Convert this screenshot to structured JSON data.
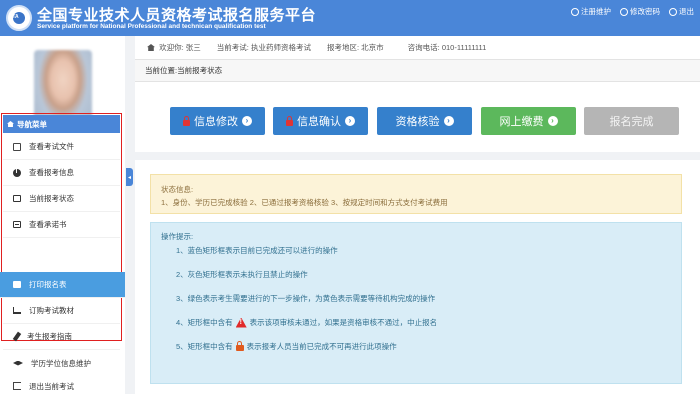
{
  "header": {
    "logo_text": "PTA",
    "title": "全国专业技术人员资格考试报名服务平台",
    "subtitle": "Service platform for National Professional and technican qualification test",
    "links": [
      {
        "label": "注册维护",
        "icon": "user-circle-icon"
      },
      {
        "label": "修改密码",
        "icon": "lock-circle-icon"
      },
      {
        "label": "退出",
        "icon": "power-icon"
      }
    ]
  },
  "infobar": {
    "welcome": "欢迎你:",
    "user": "张三",
    "exam_label": "当前考试:",
    "exam_value": "执业药师资格考试",
    "region_label": "报考地区:",
    "region_value": "北京市",
    "phone_label": "咨询电话:",
    "phone_value": "010-11111111"
  },
  "breadcrumb": {
    "label": "当前位置:",
    "value": "当前报考状态"
  },
  "steps": [
    {
      "label": "信息修改",
      "style": "blue",
      "locked": true
    },
    {
      "label": "信息确认",
      "style": "blue",
      "locked": true
    },
    {
      "label": "资格核验",
      "style": "blue",
      "locked": false
    },
    {
      "label": "网上缴费",
      "style": "green",
      "locked": false
    },
    {
      "label": "报名完成",
      "style": "gray",
      "locked": false
    }
  ],
  "sidebar": {
    "nav_title": "导航菜单",
    "items": [
      {
        "label": "查看考试文件",
        "icon": "document-icon"
      },
      {
        "label": "查看报考信息",
        "icon": "info-icon"
      },
      {
        "label": "当前报考状态",
        "icon": "monitor-icon"
      },
      {
        "label": "查看承诺书",
        "icon": "id-card-icon"
      },
      {
        "label": "打印报名表",
        "icon": "printer-icon",
        "active": true
      },
      {
        "label": "订购考试教材",
        "icon": "cart-icon"
      },
      {
        "label": "考生报考指南",
        "icon": "pencil-icon"
      },
      {
        "label": "学历学位信息维护",
        "icon": "graduation-cap-icon"
      }
    ],
    "exit_label": "退出当前考试"
  },
  "status": {
    "title": "状态信息:",
    "text": "1、身份、学历已完成核验 2、已通过报考资格核验 3、按规定时间和方式支付考试费用"
  },
  "operations": {
    "title": "操作提示:",
    "lines": [
      "1、蓝色矩形框表示目前已完成还可以进行的操作",
      "2、灰色矩形框表示未执行且禁止的操作",
      "3、绿色表示考生需要进行的下一步操作，为黄色表示需要等待机构完成的操作",
      "4、矩形框中含有",
      "表示该项审核未通过，如果是资格审核不通过，中止报名",
      "5、矩形框中含有",
      "表示报考人员当前已完成不可再进行此项操作"
    ]
  },
  "colors": {
    "header": "#4a86d8",
    "step_blue": "#3580cc",
    "step_green": "#5cb85c",
    "step_gray": "#b5b5b5",
    "highlight_border": "#e02020"
  }
}
